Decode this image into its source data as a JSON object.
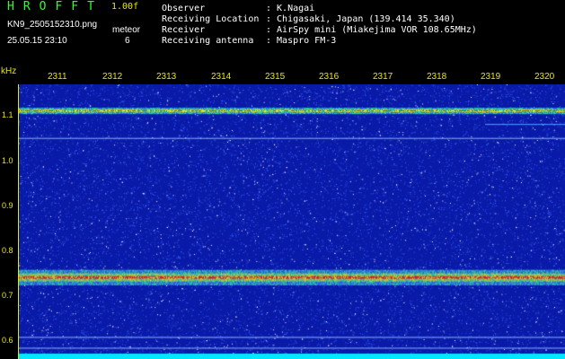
{
  "header": {
    "app_title": "HROFFT",
    "version": "1.00f",
    "file_name": "KN9_2505152310.png",
    "meteor_label": "meteor",
    "timestamp": "25.05.15 23:10",
    "meteor_count": "6"
  },
  "station_info": [
    {
      "key": "Observer",
      "value": ": K.Nagai"
    },
    {
      "key": "Receiving Location",
      "value": ": Chigasaki, Japan (139.414 35.340)"
    },
    {
      "key": "Receiver",
      "value": ": AirSpy mini (Miakejima VOR 108.65MHz)"
    },
    {
      "key": "Receiving antenna",
      "value": ": Maspro FM-3"
    }
  ],
  "spectrogram": {
    "y_unit": "kHz",
    "y_ticks": [
      "1.1",
      "1.0",
      "0.9",
      "0.8",
      "0.7",
      "0.6"
    ],
    "x_ticks": [
      "2311",
      "2312",
      "2313",
      "2314",
      "2315",
      "2316",
      "2317",
      "2318",
      "2319",
      "2320"
    ],
    "y_range_khz": [
      0.575,
      1.185
    ],
    "x_range_minutes": [
      2310.6,
      2320.6
    ],
    "colors": {
      "background": "#0a1aa8",
      "noise": "#3c64ff",
      "strong": "#ff2010",
      "medium": "#f0f020",
      "weak": "#30e0a0",
      "axis": "#e8e800"
    }
  }
}
